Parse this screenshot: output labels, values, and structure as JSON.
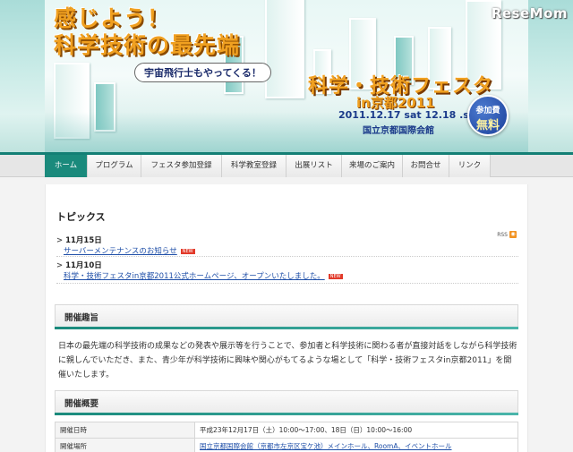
{
  "banner": {
    "headline_line1": "感じよう！",
    "headline_line2": "科学技術の最先端",
    "subhead": "宇宙飛行士もやってくる！",
    "fest_title": "科学・技術フェスタ",
    "fest_sub": "in京都2011",
    "fest_date": "2011.12.17 sat 12.18 .sun",
    "fest_venue": "国立京都国際会館",
    "badge_top": "参加費",
    "badge_big": "無料",
    "logo": "ReseMom"
  },
  "nav": {
    "items": [
      {
        "label": "ホーム"
      },
      {
        "label": "プログラム"
      },
      {
        "label": "フェスタ参加登録"
      },
      {
        "label": "科学教室登録"
      },
      {
        "label": "出展リスト"
      },
      {
        "label": "来場のご案内"
      },
      {
        "label": "お問合せ"
      },
      {
        "label": "リンク"
      }
    ]
  },
  "topics": {
    "title": "トピックス",
    "rss": "RSS",
    "items": [
      {
        "date": "11月15日",
        "text": "サーバーメンテナンスのお知らせ",
        "tag": "NEW"
      },
      {
        "date": "11月10日",
        "text": "科学・技術フェスタin京都2011公式ホームページ、オープンいたしました。",
        "tag": "NEW"
      }
    ]
  },
  "overview": {
    "title": "開催趣旨",
    "text": "日本の最先端の科学技術の成果などの発表や展示等を行うことで、参加者と科学技術に関わる者が直接対話をしながら科学技術に親しんでいただき、また、青少年が科学技術に興味や関心がもてるような場として「科学・技術フェスタin京都2011」を開催いたします。"
  },
  "summary": {
    "title": "開催概要",
    "rows": [
      {
        "key": "開催日時",
        "value": "平成23年12月17日（土）10:00～17:00、18日（日）10:00～16:00"
      },
      {
        "key": "開催場所",
        "value": "国立京都国際会館（京都市左京区宝ケ池）メインホール、RoomA、イベントホール"
      }
    ]
  },
  "colors": {
    "accent": "#1a8a7c",
    "link": "#1f4fa8",
    "headline": "#f0a020"
  }
}
